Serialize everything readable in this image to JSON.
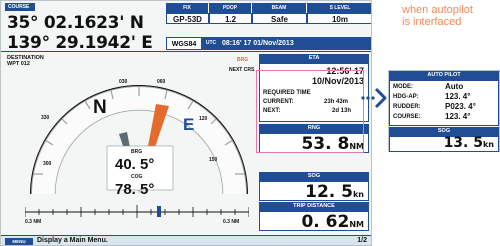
{
  "screen": {
    "tab": "COURSE",
    "position": {
      "lat": "35° 02.1623' N",
      "lon": "139° 29.1942' E"
    },
    "status_row": {
      "headers": [
        "FIX",
        "PDOP",
        "BEAM",
        "S LEVEL"
      ],
      "values": [
        "GP-53D",
        "1.2",
        "Safe",
        "10m"
      ],
      "datum": "WGS84",
      "utc_label": "UTC",
      "utc": "08:16' 17 01/Nov/2013"
    },
    "destination": {
      "label": "DESTINATION",
      "wpt": "WPT 012"
    },
    "gauge": {
      "brg_label": "BRG",
      "next_crs_label": "NEXT CRS",
      "ticks": [
        "030",
        "060",
        "120",
        "150",
        "330",
        "300"
      ],
      "north": "N",
      "east": "E",
      "brg_title": "BRG",
      "brg_value": "40. 5°",
      "cog_title": "COG",
      "cog_value": "78. 5°",
      "scale_left": "0.3 NM",
      "scale_right": "0.3 NM"
    },
    "eta": {
      "header": "ETA",
      "time": "12:56' 17",
      "date": "10/Nov/2013",
      "required_label": "REQUIRED TIME",
      "current_label": "CURRENT:",
      "current_value": "23h 43m",
      "next_label": "NEXT:",
      "next_value": "2d 13h"
    },
    "rng": {
      "header": "RNG",
      "value": "53. 8",
      "unit": "NM"
    },
    "sog": {
      "header": "SOG",
      "value": "12. 5",
      "unit": "kn"
    },
    "trip": {
      "header": "TRIP DISTANCE",
      "value": "0. 62",
      "unit": "NM"
    },
    "status_bar": {
      "chip": "MENU",
      "message": "Display a Main Menu.",
      "page": "1/2"
    }
  },
  "annotation": {
    "note": "when autopilot\nis interfaced",
    "arrow_glyph": "›",
    "autopilot": {
      "header": "AUTO PILOT",
      "rows": [
        {
          "label": "MODE:",
          "value": "Auto"
        },
        {
          "label": "HDG-AP:",
          "value": "123. 4°"
        },
        {
          "label": "RUDDER:",
          "value": "P023. 4°"
        },
        {
          "label": "COURSE:",
          "value": "123. 4°"
        }
      ],
      "sog_header": "SOG",
      "sog_value": "13. 5",
      "sog_unit": "kn"
    }
  },
  "colors": {
    "panel_blue": "#1f4e96",
    "needle": "#e36b2c",
    "note_orange": "#ee8a5a",
    "highlight": "#e07ab0"
  }
}
